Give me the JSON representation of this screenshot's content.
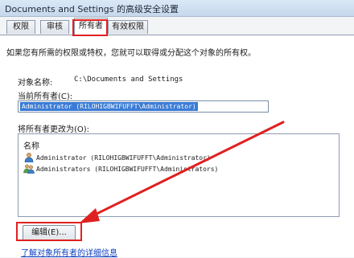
{
  "window": {
    "title": "Documents and Settings 的高级安全设置"
  },
  "tabs": [
    {
      "label": "权限",
      "active": false
    },
    {
      "label": "审核",
      "active": false
    },
    {
      "label": "所有者",
      "active": true
    },
    {
      "label": "有效权限",
      "active": false
    }
  ],
  "owner_panel": {
    "intro": "如果您有所需的权限或特权，您就可以取得或分配这个对象的所有权。",
    "object_name_label": "对象名称:",
    "object_name_value": "C:\\Documents and Settings",
    "current_owner_label": "当前所有者(C):",
    "current_owner_value": "Administrator (RILOHIGBWIFUFFT\\Administrator)",
    "change_owner_label": "将所有者更改为(O):",
    "list": {
      "header": "名称",
      "items": [
        {
          "text": "Administrator (RILOHIGBWIFUFFT\\Administrator)",
          "icon": "user-icon"
        },
        {
          "text": "Administrators (RILOHIGBWIFUFFT\\Administrators)",
          "icon": "group-icon"
        }
      ]
    },
    "edit_button": "编辑(E)...",
    "help_link": "了解对象所有者的详细信息"
  },
  "annotation": {
    "highlight_color": "#e02020"
  }
}
